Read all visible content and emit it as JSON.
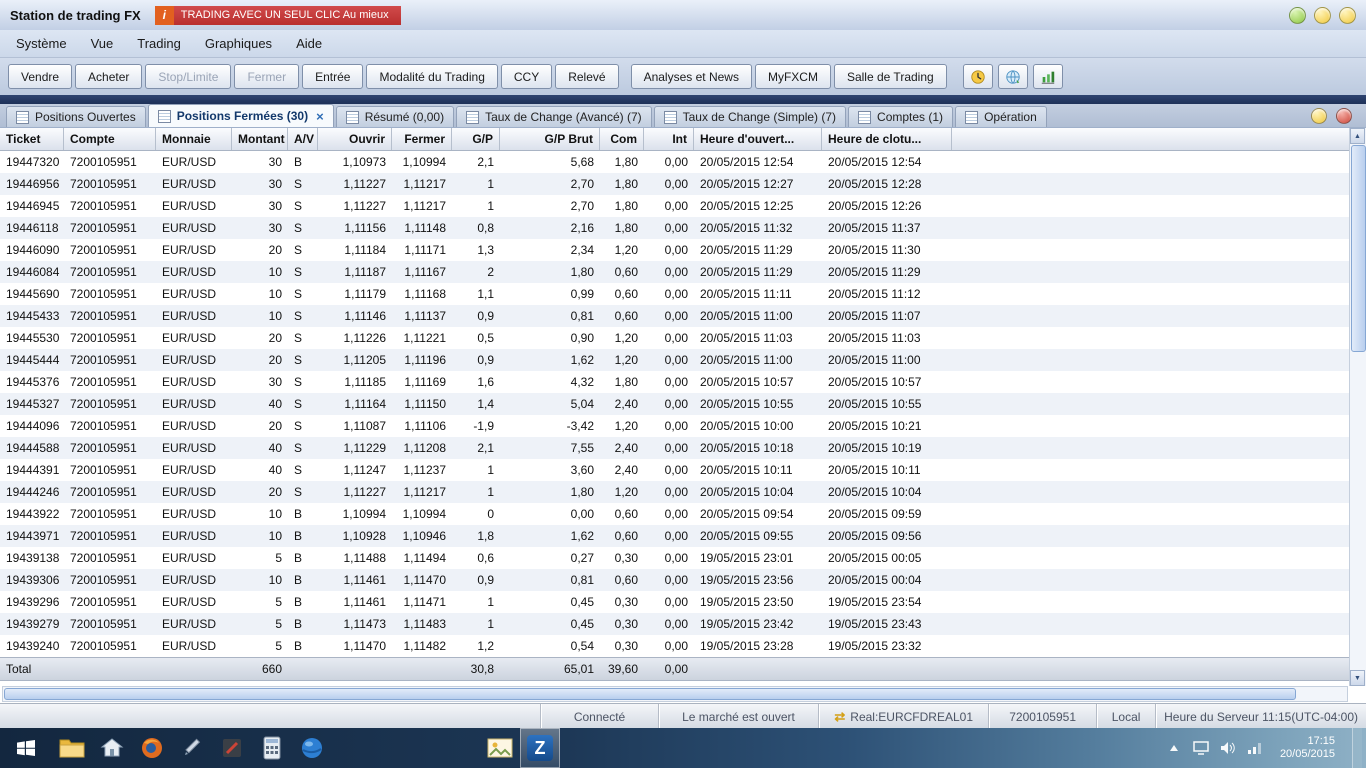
{
  "window": {
    "title": "Station de trading FX",
    "banner_icon": "i",
    "banner_text": "TRADING AVEC UN SEUL CLIC Au mieux"
  },
  "icons": {
    "scroll_up": "▲",
    "scroll_down": "▼",
    "tab_close": "×",
    "currency_swap": "⇄"
  },
  "menu": {
    "items": [
      "Système",
      "Vue",
      "Trading",
      "Graphiques",
      "Aide"
    ]
  },
  "toolbar": {
    "trade_buttons": [
      {
        "label": "Vendre",
        "enabled": true
      },
      {
        "label": "Acheter",
        "enabled": true
      },
      {
        "label": "Stop/Limite",
        "enabled": false
      },
      {
        "label": "Fermer",
        "enabled": false
      },
      {
        "label": "Entrée",
        "enabled": true
      },
      {
        "label": "Modalité du Trading",
        "enabled": true
      },
      {
        "label": "CCY",
        "enabled": true
      },
      {
        "label": "Relevé",
        "enabled": true
      }
    ],
    "info_buttons": [
      {
        "label": "Analyses et News",
        "enabled": true
      },
      {
        "label": "MyFXCM",
        "enabled": true
      },
      {
        "label": "Salle de Trading",
        "enabled": true
      }
    ],
    "icon_buttons": [
      "clock-icon",
      "world-clock-icon",
      "chart-icon"
    ]
  },
  "tabs": [
    {
      "label": "Positions Ouvertes",
      "active": false,
      "closable": false
    },
    {
      "label": "Positions Fermées (30)",
      "active": true,
      "closable": true
    },
    {
      "label": "Résumé (0,00)",
      "active": false,
      "closable": false
    },
    {
      "label": "Taux de Change (Avancé) (7)",
      "active": false,
      "closable": false
    },
    {
      "label": "Taux de Change (Simple) (7)",
      "active": false,
      "closable": false
    },
    {
      "label": "Comptes (1)",
      "active": false,
      "closable": false
    },
    {
      "label": "Opération",
      "active": false,
      "closable": false
    }
  ],
  "table": {
    "columns": [
      "Ticket",
      "Compte",
      "Monnaie",
      "Montant",
      "A/V",
      "Ouvrir",
      "Fermer",
      "G/P",
      "G/P Brut",
      "Com",
      "Int",
      "Heure d'ouvert...",
      "Heure de clotu..."
    ],
    "rows": [
      [
        "19447320",
        "7200105951",
        "EUR/USD",
        "30",
        "B",
        "1,10973",
        "1,10994",
        "2,1",
        "5,68",
        "1,80",
        "0,00",
        "20/05/2015 12:54",
        "20/05/2015 12:54"
      ],
      [
        "19446956",
        "7200105951",
        "EUR/USD",
        "30",
        "S",
        "1,11227",
        "1,11217",
        "1",
        "2,70",
        "1,80",
        "0,00",
        "20/05/2015 12:27",
        "20/05/2015 12:28"
      ],
      [
        "19446945",
        "7200105951",
        "EUR/USD",
        "30",
        "S",
        "1,11227",
        "1,11217",
        "1",
        "2,70",
        "1,80",
        "0,00",
        "20/05/2015 12:25",
        "20/05/2015 12:26"
      ],
      [
        "19446118",
        "7200105951",
        "EUR/USD",
        "30",
        "S",
        "1,11156",
        "1,11148",
        "0,8",
        "2,16",
        "1,80",
        "0,00",
        "20/05/2015 11:32",
        "20/05/2015 11:37"
      ],
      [
        "19446090",
        "7200105951",
        "EUR/USD",
        "20",
        "S",
        "1,11184",
        "1,11171",
        "1,3",
        "2,34",
        "1,20",
        "0,00",
        "20/05/2015 11:29",
        "20/05/2015 11:30"
      ],
      [
        "19446084",
        "7200105951",
        "EUR/USD",
        "10",
        "S",
        "1,11187",
        "1,11167",
        "2",
        "1,80",
        "0,60",
        "0,00",
        "20/05/2015 11:29",
        "20/05/2015 11:29"
      ],
      [
        "19445690",
        "7200105951",
        "EUR/USD",
        "10",
        "S",
        "1,11179",
        "1,11168",
        "1,1",
        "0,99",
        "0,60",
        "0,00",
        "20/05/2015 11:11",
        "20/05/2015 11:12"
      ],
      [
        "19445433",
        "7200105951",
        "EUR/USD",
        "10",
        "S",
        "1,11146",
        "1,11137",
        "0,9",
        "0,81",
        "0,60",
        "0,00",
        "20/05/2015 11:00",
        "20/05/2015 11:07"
      ],
      [
        "19445530",
        "7200105951",
        "EUR/USD",
        "20",
        "S",
        "1,11226",
        "1,11221",
        "0,5",
        "0,90",
        "1,20",
        "0,00",
        "20/05/2015 11:03",
        "20/05/2015 11:03"
      ],
      [
        "19445444",
        "7200105951",
        "EUR/USD",
        "20",
        "S",
        "1,11205",
        "1,11196",
        "0,9",
        "1,62",
        "1,20",
        "0,00",
        "20/05/2015 11:00",
        "20/05/2015 11:00"
      ],
      [
        "19445376",
        "7200105951",
        "EUR/USD",
        "30",
        "S",
        "1,11185",
        "1,11169",
        "1,6",
        "4,32",
        "1,80",
        "0,00",
        "20/05/2015 10:57",
        "20/05/2015 10:57"
      ],
      [
        "19445327",
        "7200105951",
        "EUR/USD",
        "40",
        "S",
        "1,11164",
        "1,11150",
        "1,4",
        "5,04",
        "2,40",
        "0,00",
        "20/05/2015 10:55",
        "20/05/2015 10:55"
      ],
      [
        "19444096",
        "7200105951",
        "EUR/USD",
        "20",
        "S",
        "1,11087",
        "1,11106",
        "-1,9",
        "-3,42",
        "1,20",
        "0,00",
        "20/05/2015 10:00",
        "20/05/2015 10:21"
      ],
      [
        "19444588",
        "7200105951",
        "EUR/USD",
        "40",
        "S",
        "1,11229",
        "1,11208",
        "2,1",
        "7,55",
        "2,40",
        "0,00",
        "20/05/2015 10:18",
        "20/05/2015 10:19"
      ],
      [
        "19444391",
        "7200105951",
        "EUR/USD",
        "40",
        "S",
        "1,11247",
        "1,11237",
        "1",
        "3,60",
        "2,40",
        "0,00",
        "20/05/2015 10:11",
        "20/05/2015 10:11"
      ],
      [
        "19444246",
        "7200105951",
        "EUR/USD",
        "20",
        "S",
        "1,11227",
        "1,11217",
        "1",
        "1,80",
        "1,20",
        "0,00",
        "20/05/2015 10:04",
        "20/05/2015 10:04"
      ],
      [
        "19443922",
        "7200105951",
        "EUR/USD",
        "10",
        "B",
        "1,10994",
        "1,10994",
        "0",
        "0,00",
        "0,60",
        "0,00",
        "20/05/2015 09:54",
        "20/05/2015 09:59"
      ],
      [
        "19443971",
        "7200105951",
        "EUR/USD",
        "10",
        "B",
        "1,10928",
        "1,10946",
        "1,8",
        "1,62",
        "0,60",
        "0,00",
        "20/05/2015 09:55",
        "20/05/2015 09:56"
      ],
      [
        "19439138",
        "7200105951",
        "EUR/USD",
        "5",
        "B",
        "1,11488",
        "1,11494",
        "0,6",
        "0,27",
        "0,30",
        "0,00",
        "19/05/2015 23:01",
        "20/05/2015 00:05"
      ],
      [
        "19439306",
        "7200105951",
        "EUR/USD",
        "10",
        "B",
        "1,11461",
        "1,11470",
        "0,9",
        "0,81",
        "0,60",
        "0,00",
        "19/05/2015 23:56",
        "20/05/2015 00:04"
      ],
      [
        "19439296",
        "7200105951",
        "EUR/USD",
        "5",
        "B",
        "1,11461",
        "1,11471",
        "1",
        "0,45",
        "0,30",
        "0,00",
        "19/05/2015 23:50",
        "19/05/2015 23:54"
      ],
      [
        "19439279",
        "7200105951",
        "EUR/USD",
        "5",
        "B",
        "1,11473",
        "1,11483",
        "1",
        "0,45",
        "0,30",
        "0,00",
        "19/05/2015 23:42",
        "19/05/2015 23:43"
      ],
      [
        "19439240",
        "7200105951",
        "EUR/USD",
        "5",
        "B",
        "1,11470",
        "1,11482",
        "1,2",
        "0,54",
        "0,30",
        "0,00",
        "19/05/2015 23:28",
        "19/05/2015 23:32"
      ]
    ],
    "total_row": [
      "Total",
      "",
      "",
      "660",
      "",
      "",
      "",
      "30,8",
      "65,01",
      "39,60",
      "0,00",
      "",
      ""
    ]
  },
  "statusbar": {
    "connection": "Connecté",
    "market": "Le marché est ouvert",
    "account_label": "Real:EURCFDREAL01",
    "account_number": "7200105951",
    "mode": "Local",
    "server_time": "Heure du Serveur 11:15(UTC-04:00)"
  },
  "taskbar": {
    "clock_time": "17:15",
    "clock_date": "20/05/2015",
    "app_icons": [
      "start",
      "file-explorer",
      "home",
      "firefox",
      "pen",
      "tools",
      "calculator",
      "browser-ball",
      "photos",
      "trading-app"
    ]
  }
}
